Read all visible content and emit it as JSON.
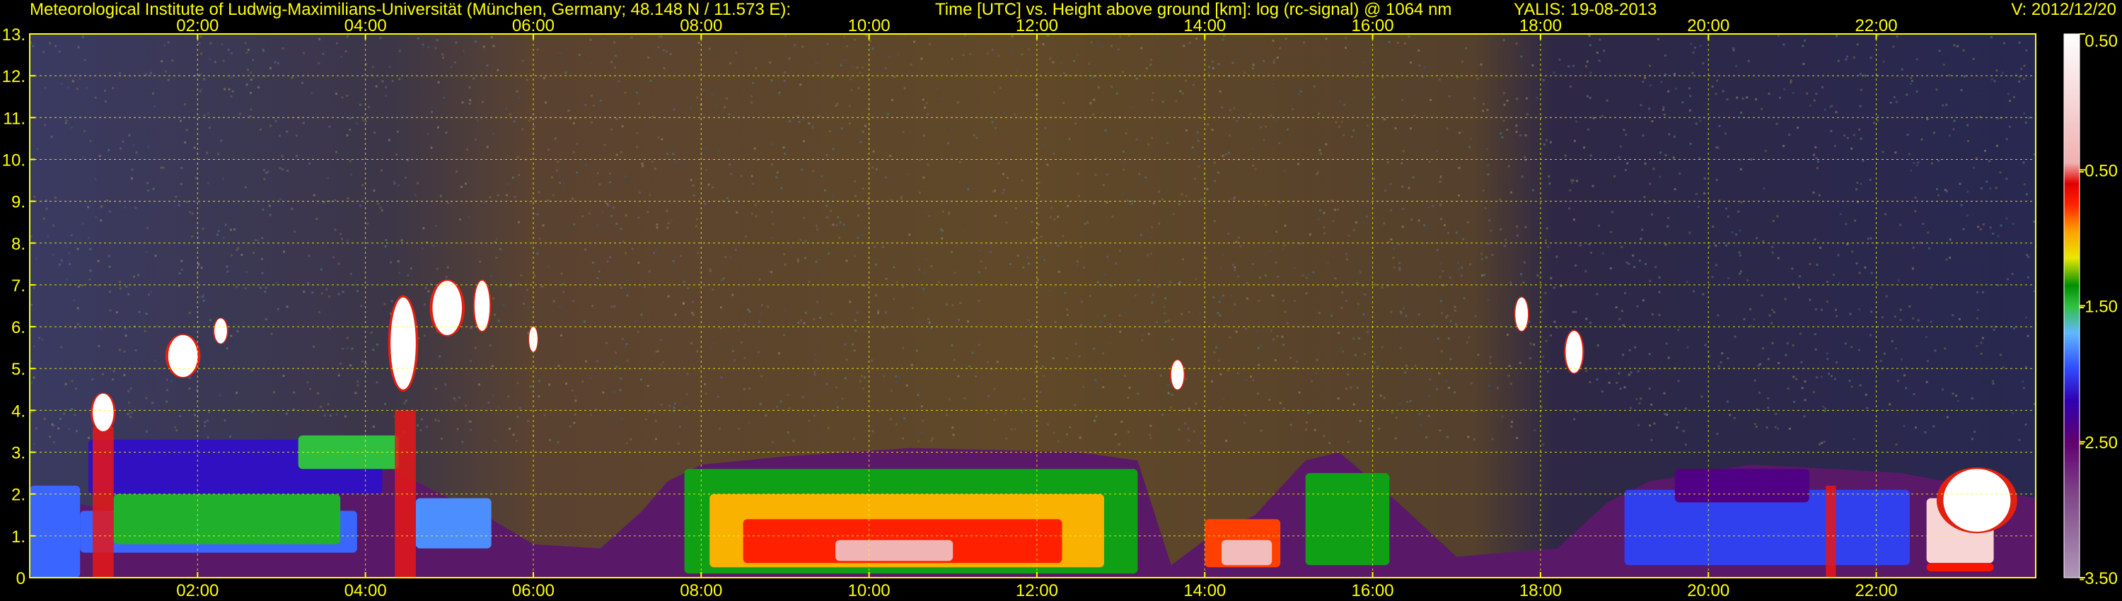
{
  "header": {
    "institute": "Meteorological Institute of Ludwig-Maximilians-Universität (München, Germany; 48.148 N / 11.573 E):",
    "plot_description": "Time [UTC] vs. Height above ground [km]: log (rc-signal) @ 1064 nm",
    "instrument_date": "YALIS: 19-08-2013",
    "version": "V: 2012/12/20"
  },
  "chart_data": {
    "type": "heatmap",
    "title": "Time [UTC] vs. Height above ground [km]: log (rc-signal) @ 1064 nm",
    "xlabel": "Time [UTC]",
    "ylabel": "Height above ground [km]",
    "x_unit": "hours UTC",
    "xlim": [
      0.0,
      23.9
    ],
    "ylim": [
      0,
      13
    ],
    "x_ticks": [
      2,
      4,
      6,
      8,
      10,
      12,
      14,
      16,
      18,
      20,
      22
    ],
    "x_tick_labels": [
      "02:00",
      "04:00",
      "06:00",
      "08:00",
      "10:00",
      "12:00",
      "14:00",
      "16:00",
      "18:00",
      "20:00",
      "22:00"
    ],
    "y_ticks": [
      0,
      1,
      2,
      3,
      4,
      5,
      6,
      7,
      8,
      9,
      10,
      11,
      12,
      13
    ],
    "y_tick_labels": [
      "0",
      "1.",
      "2.",
      "3.",
      "4.",
      "5.",
      "6.",
      "7.",
      "8.",
      "9.",
      "10.",
      "11.",
      "12.",
      "13."
    ],
    "grid": true,
    "colorbar": {
      "range": [
        -3.5,
        0.5
      ],
      "tick_values": [
        0.5,
        -0.5,
        -1.5,
        -2.5,
        -3.5
      ],
      "tick_labels": [
        "0.50",
        "-0.50",
        "-1.50",
        "-2.50",
        "-3.50"
      ],
      "stops": [
        {
          "value": -3.5,
          "color": "#b098b8"
        },
        {
          "value": -2.9,
          "color": "#804888"
        },
        {
          "value": -2.5,
          "color": "#600070"
        },
        {
          "value": -2.2,
          "color": "#3000b0"
        },
        {
          "value": -1.95,
          "color": "#3050ff"
        },
        {
          "value": -1.7,
          "color": "#60b8ff"
        },
        {
          "value": -1.5,
          "color": "#30c040"
        },
        {
          "value": -1.35,
          "color": "#009000"
        },
        {
          "value": -1.15,
          "color": "#e8e800"
        },
        {
          "value": -0.95,
          "color": "#ffa000"
        },
        {
          "value": -0.75,
          "color": "#ff2000"
        },
        {
          "value": -0.6,
          "color": "#e00000"
        },
        {
          "value": -0.45,
          "color": "#f0b0b0"
        },
        {
          "value": 0.5,
          "color": "#ffffff"
        }
      ]
    },
    "colors": {
      "background": "#000000",
      "text": "#ffff00",
      "grid": "#ffff00",
      "frame": "#ffff00",
      "colorbar_frame": "#ffffff"
    },
    "features": {
      "ground_layer": {
        "points": [
          [
            0.0,
            2.2
          ],
          [
            0.5,
            1.8
          ],
          [
            1.0,
            1.6
          ],
          [
            3.0,
            1.9
          ],
          [
            4.3,
            2.6
          ],
          [
            5.5,
            1.4
          ],
          [
            6.0,
            0.8
          ],
          [
            6.8,
            0.7
          ],
          [
            7.3,
            1.6
          ],
          [
            7.6,
            2.3
          ],
          [
            8.0,
            2.7
          ],
          [
            9.0,
            2.9
          ],
          [
            10.5,
            3.1
          ],
          [
            12.5,
            3.0
          ],
          [
            13.2,
            2.8
          ],
          [
            13.6,
            0.3
          ],
          [
            14.0,
            0.9
          ],
          [
            14.6,
            1.5
          ],
          [
            15.2,
            2.8
          ],
          [
            15.6,
            3.0
          ],
          [
            16.3,
            1.8
          ],
          [
            17.0,
            0.5
          ],
          [
            18.2,
            0.7
          ],
          [
            18.8,
            1.8
          ],
          [
            19.3,
            2.3
          ],
          [
            20.5,
            2.7
          ],
          [
            21.5,
            2.6
          ],
          [
            22.3,
            2.5
          ],
          [
            23.9,
            1.9
          ]
        ]
      },
      "bands": [
        {
          "x0": 0.0,
          "x1": 0.6,
          "y0": 0.0,
          "y1": 2.2,
          "value": -1.9
        },
        {
          "x0": 0.6,
          "x1": 3.9,
          "y0": 0.6,
          "y1": 1.6,
          "value": -1.9
        },
        {
          "x0": 1.0,
          "x1": 3.7,
          "y0": 0.8,
          "y1": 2.0,
          "value": -1.45
        },
        {
          "x0": 0.7,
          "x1": 4.2,
          "y0": 2.0,
          "y1": 3.3,
          "value": -2.15
        },
        {
          "x0": 3.2,
          "x1": 4.4,
          "y0": 2.6,
          "y1": 3.4,
          "value": -1.5
        },
        {
          "x0": 4.6,
          "x1": 5.5,
          "y0": 0.7,
          "y1": 1.9,
          "value": -1.8
        },
        {
          "x0": 7.8,
          "x1": 13.2,
          "y0": 0.1,
          "y1": 2.6,
          "value": -1.4
        },
        {
          "x0": 8.1,
          "x1": 12.8,
          "y0": 0.25,
          "y1": 2.0,
          "value": -1.0
        },
        {
          "x0": 8.5,
          "x1": 12.3,
          "y0": 0.35,
          "y1": 1.4,
          "value": -0.75
        },
        {
          "x0": 9.6,
          "x1": 11.0,
          "y0": 0.4,
          "y1": 0.9,
          "value": -0.4
        },
        {
          "x0": 14.0,
          "x1": 14.9,
          "y0": 0.25,
          "y1": 1.4,
          "value": -0.8
        },
        {
          "x0": 14.2,
          "x1": 14.8,
          "y0": 0.3,
          "y1": 0.9,
          "value": -0.3
        },
        {
          "x0": 15.2,
          "x1": 16.2,
          "y0": 0.3,
          "y1": 2.5,
          "value": -1.4
        },
        {
          "x0": 19.0,
          "x1": 22.4,
          "y0": 0.3,
          "y1": 2.1,
          "value": -2.0
        },
        {
          "x0": 19.6,
          "x1": 21.2,
          "y0": 1.8,
          "y1": 2.6,
          "value": -2.4
        },
        {
          "x0": 22.6,
          "x1": 23.4,
          "y0": 0.35,
          "y1": 1.9,
          "value": 0.0
        },
        {
          "x0": 22.6,
          "x1": 23.4,
          "y0": 0.15,
          "y1": 0.35,
          "value": -0.7
        }
      ],
      "clouds": [
        {
          "x": 0.75,
          "y": 3.5,
          "w": 0.25,
          "h": 0.9
        },
        {
          "x": 1.65,
          "y": 4.8,
          "w": 0.35,
          "h": 1.0
        },
        {
          "x": 2.2,
          "y": 5.6,
          "w": 0.15,
          "h": 0.6
        },
        {
          "x": 4.3,
          "y": 4.5,
          "w": 0.3,
          "h": 2.2
        },
        {
          "x": 4.8,
          "y": 5.8,
          "w": 0.35,
          "h": 1.3
        },
        {
          "x": 5.3,
          "y": 5.9,
          "w": 0.18,
          "h": 1.2
        },
        {
          "x": 5.95,
          "y": 5.4,
          "w": 0.1,
          "h": 0.6
        },
        {
          "x": 13.6,
          "y": 4.5,
          "w": 0.15,
          "h": 0.7
        },
        {
          "x": 17.7,
          "y": 5.9,
          "w": 0.15,
          "h": 0.8
        },
        {
          "x": 18.3,
          "y": 4.9,
          "w": 0.2,
          "h": 1.0
        },
        {
          "x": 22.8,
          "y": 1.1,
          "w": 0.8,
          "h": 1.5
        }
      ],
      "precip_columns": [
        {
          "x": 0.75,
          "y_top": 3.6,
          "w": 0.25
        },
        {
          "x": 4.35,
          "y_top": 4.0,
          "w": 0.25
        },
        {
          "x": 21.4,
          "y_top": 2.2,
          "w": 0.12
        }
      ]
    }
  }
}
